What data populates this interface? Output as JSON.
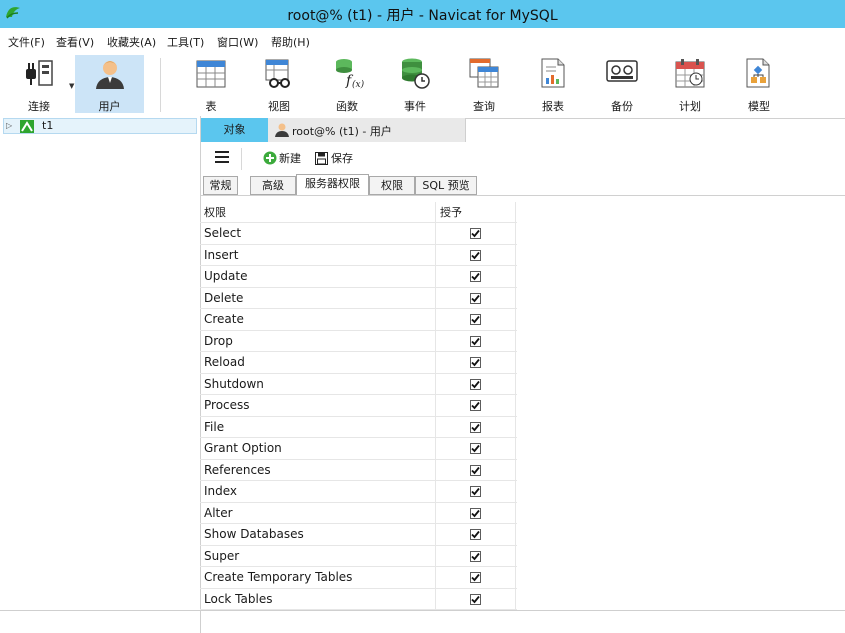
{
  "window": {
    "title": "root@% (t1) - 用户 - Navicat for MySQL"
  },
  "menu": [
    "文件(F)",
    "查看(V)",
    "收藏夹(A)",
    "工具(T)",
    "窗口(W)",
    "帮助(H)"
  ],
  "toolbar": {
    "connect": "连接",
    "user": "用户",
    "table": "表",
    "view": "视图",
    "function": "函数",
    "event": "事件",
    "query": "查询",
    "report": "报表",
    "backup": "备份",
    "schedule": "计划",
    "model": "模型"
  },
  "tree": {
    "item": "t1"
  },
  "tabs": {
    "objects": "对象",
    "user_tab": "root@% (t1) - 用户"
  },
  "actions": {
    "new": "新建",
    "save": "保存"
  },
  "subtabs": [
    "常规",
    "高级",
    "服务器权限",
    "权限",
    "SQL 预览"
  ],
  "subtabs_active": "服务器权限",
  "grid": {
    "col_privilege": "权限",
    "col_grant": "授予",
    "rows": [
      {
        "name": "Select",
        "granted": true
      },
      {
        "name": "Insert",
        "granted": true
      },
      {
        "name": "Update",
        "granted": true
      },
      {
        "name": "Delete",
        "granted": true
      },
      {
        "name": "Create",
        "granted": true
      },
      {
        "name": "Drop",
        "granted": true
      },
      {
        "name": "Reload",
        "granted": true
      },
      {
        "name": "Shutdown",
        "granted": true
      },
      {
        "name": "Process",
        "granted": true
      },
      {
        "name": "File",
        "granted": true
      },
      {
        "name": "Grant Option",
        "granted": true
      },
      {
        "name": "References",
        "granted": true
      },
      {
        "name": "Index",
        "granted": true
      },
      {
        "name": "Alter",
        "granted": true
      },
      {
        "name": "Show Databases",
        "granted": true
      },
      {
        "name": "Super",
        "granted": true
      },
      {
        "name": "Create Temporary Tables",
        "granted": true
      },
      {
        "name": "Lock Tables",
        "granted": true
      }
    ]
  },
  "colors": {
    "titlebar": "#5bc6ee",
    "active_tool": "#cce4f7",
    "accent_green": "#2fa52f"
  }
}
